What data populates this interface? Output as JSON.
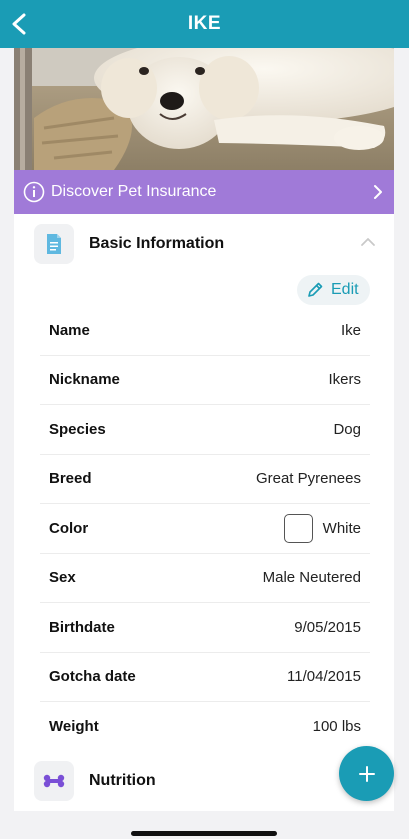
{
  "colors": {
    "accent": "#1a9cb5",
    "insurance_bg": "#a07ad8",
    "nutrition_icon": "#7a4fd6"
  },
  "header": {
    "title": "IKE",
    "back_icon": "chevron-left-icon"
  },
  "banner": {
    "label": "Discover Pet Insurance",
    "info_icon": "info-circle-icon",
    "chevron_icon": "chevron-right-icon"
  },
  "basic_info": {
    "title": "Basic Information",
    "icon": "document-icon",
    "edit_label": "Edit",
    "rows": [
      {
        "key": "Name",
        "value": "Ike"
      },
      {
        "key": "Nickname",
        "value": "Ikers"
      },
      {
        "key": "Species",
        "value": "Dog"
      },
      {
        "key": "Breed",
        "value": "Great Pyrenees"
      },
      {
        "key": "Color",
        "value": "White",
        "swatch": "#ffffff"
      },
      {
        "key": "Sex",
        "value": "Male Neutered"
      },
      {
        "key": "Birthdate",
        "value": "9/05/2015"
      },
      {
        "key": "Gotcha date",
        "value": "11/04/2015"
      },
      {
        "key": "Weight",
        "value": "100 lbs"
      }
    ]
  },
  "nutrition": {
    "title": "Nutrition",
    "icon": "bone-icon"
  },
  "fab": {
    "icon": "plus-icon"
  }
}
